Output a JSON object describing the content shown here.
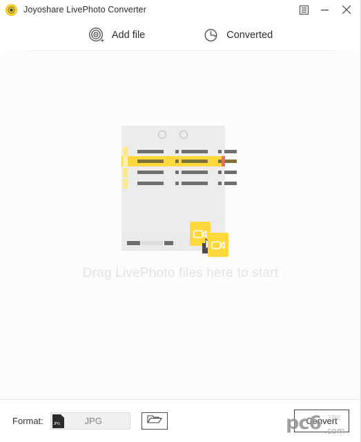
{
  "window": {
    "title": "Joyoshare LivePhoto Converter",
    "logo_icon": "app-logo-icon",
    "controls": {
      "menu_icon": "menu-icon",
      "minimize_icon": "minimize-icon",
      "close_icon": "close-icon"
    }
  },
  "toolbar": {
    "items": [
      {
        "label": "Add file",
        "icon": "add-file-icon"
      },
      {
        "label": "Converted",
        "icon": "history-clock-icon"
      }
    ]
  },
  "main": {
    "drop_hint": "Drag LivePhoto files here to start",
    "illustration": {
      "name": "drag-drop-illustration",
      "video_card_icon": "video-camera-icon",
      "cursor_icon": "cursor-arrow-icon",
      "accent_color": "#ffd93b",
      "marker_color": "#f2675e"
    }
  },
  "bottom": {
    "format_label": "Format:",
    "format_value": "JPG",
    "format_file_icon": "jpg-file-icon",
    "folder_icon": "folder-open-icon",
    "convert_label": "Convert"
  },
  "watermark": {
    "brand": "pc6",
    "suffix": ".com",
    "subtext": "下载站"
  }
}
